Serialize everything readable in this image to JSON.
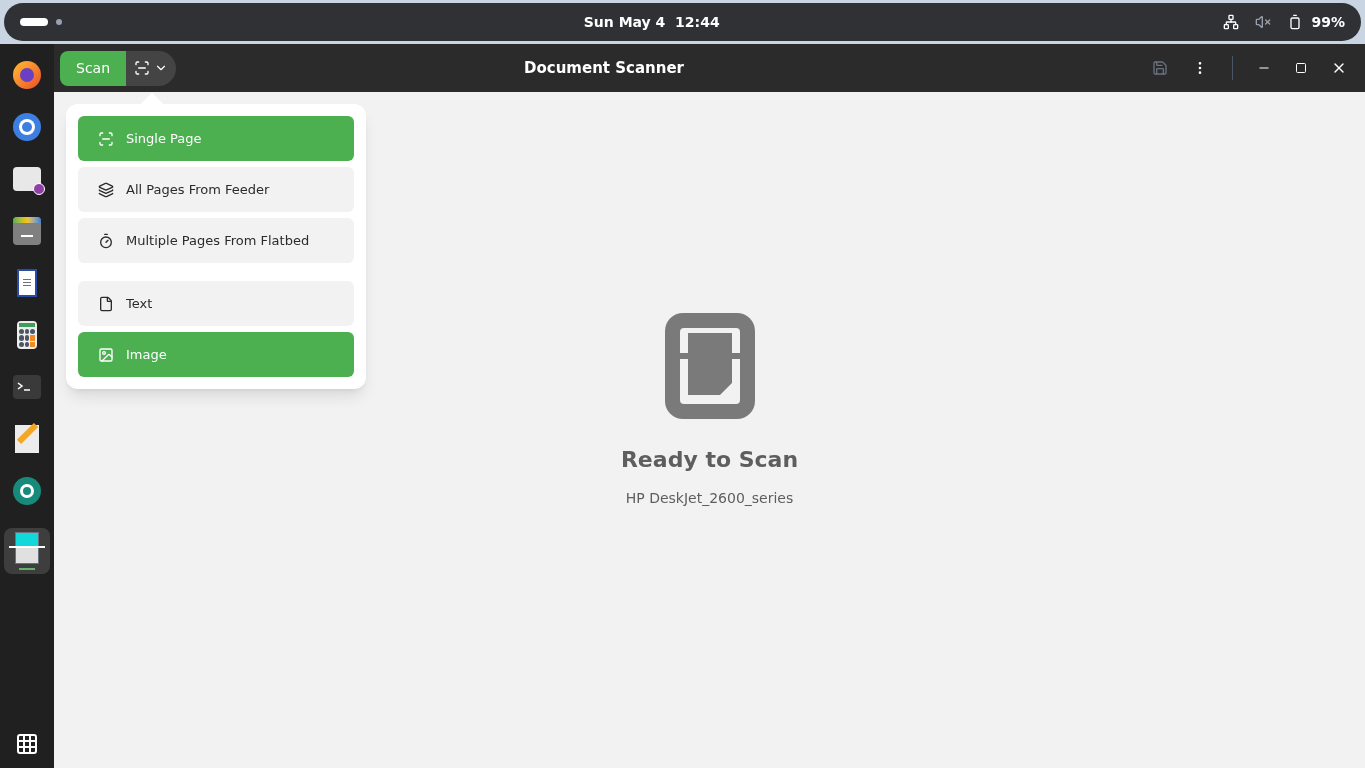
{
  "top_bar": {
    "clock": "Sun May 4  12:44",
    "battery": "99%"
  },
  "dock": [
    {
      "kind": "browser",
      "selected": false
    },
    {
      "kind": "chrome",
      "selected": false
    },
    {
      "kind": "mail",
      "selected": false
    },
    {
      "kind": "files",
      "selected": false
    },
    {
      "kind": "writer",
      "selected": false
    },
    {
      "kind": "calculator",
      "selected": false
    },
    {
      "kind": "terminal",
      "selected": false
    },
    {
      "kind": "editor",
      "selected": false
    },
    {
      "kind": "camera",
      "selected": false
    },
    {
      "kind": "scanner",
      "selected": true
    }
  ],
  "window": {
    "title": "Document Scanner",
    "scan_button": "Scan"
  },
  "scan_menu": {
    "groups": [
      [
        {
          "kind": "single",
          "label": "Single Page",
          "selected": true
        },
        {
          "kind": "feeder",
          "label": "All Pages From Feeder",
          "selected": false
        },
        {
          "kind": "flatbed",
          "label": "Multiple Pages From Flatbed",
          "selected": false
        }
      ],
      [
        {
          "kind": "text",
          "label": "Text",
          "selected": false
        },
        {
          "kind": "image",
          "label": "Image",
          "selected": true
        }
      ]
    ]
  },
  "status": {
    "title": "Ready to Scan",
    "device": "HP DeskJet_2600_series"
  }
}
